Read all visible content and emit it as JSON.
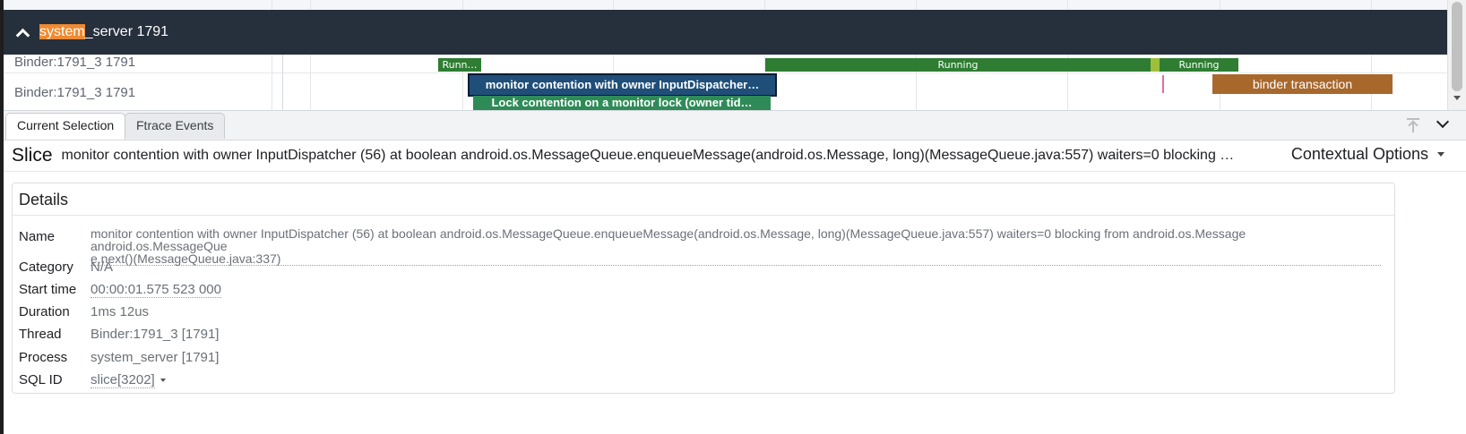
{
  "timeline": {
    "process_title_highlight": "system",
    "process_title_rest": "_server 1791",
    "tracks": [
      {
        "label": "Binder:1791_3 1791"
      },
      {
        "label": "Binder:1791_3 1791"
      }
    ],
    "slices": {
      "run1": "Runn…",
      "run2": "Running",
      "run3": "Running",
      "monitor": "monitor contention with owner InputDispatcher…",
      "lock": "Lock contention on a monitor lock (owner tid…",
      "binder": "binder transaction"
    },
    "colors": {
      "header_bg": "#262f3c",
      "highlight": "#ef8a32",
      "running": "#2e7d32",
      "selected_slice": "#1f4e79",
      "lock_slice": "#2e8b57",
      "binder": "#a8682c"
    }
  },
  "tabs": [
    {
      "label": "Current Selection",
      "active": true
    },
    {
      "label": "Ftrace Events",
      "active": false
    }
  ],
  "selection": {
    "kind": "Slice",
    "title": "monitor contention with owner InputDispatcher (56) at boolean android.os.MessageQueue.enqueueMessage(android.os.Message, long)(MessageQueue.java:557) waiters=0 blocking from android.o…",
    "contextual_options": "Contextual Options"
  },
  "details": {
    "title": "Details",
    "rows": {
      "name": {
        "key": "Name",
        "line1": "monitor contention with owner InputDispatcher (56) at boolean android.os.MessageQueue.enqueueMessage(android.os.Message, long)(MessageQueue.java:557) waiters=0 blocking from android.os.Message android.os.MessageQue",
        "line2": "e.next()(MessageQueue.java:337)"
      },
      "category": {
        "key": "Category",
        "value": "N/A"
      },
      "start_time": {
        "key": "Start time",
        "value": "00:00:01.575 523 000"
      },
      "duration": {
        "key": "Duration",
        "value": "1ms 12us"
      },
      "thread": {
        "key": "Thread",
        "value": "Binder:1791_3 [1791]"
      },
      "process": {
        "key": "Process",
        "value": "system_server [1791]"
      },
      "sql_id": {
        "key": "SQL ID",
        "value": "slice[3202]"
      }
    }
  }
}
